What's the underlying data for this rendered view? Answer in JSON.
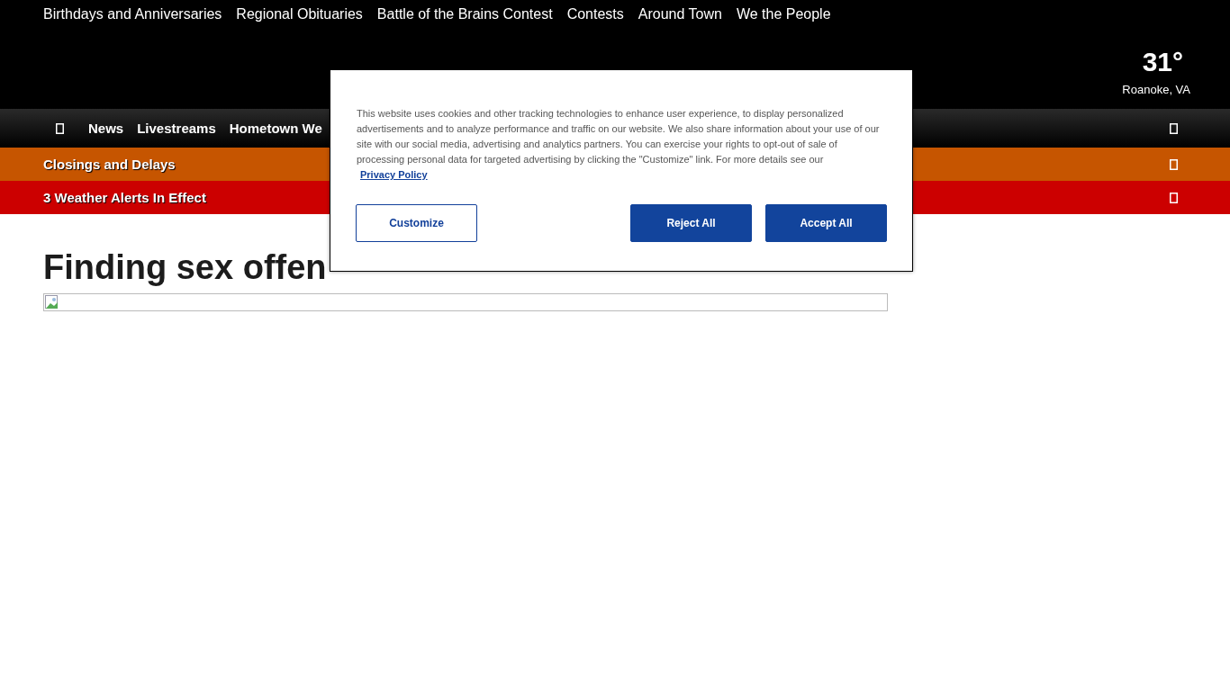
{
  "top_links": [
    "Birthdays and Anniversaries",
    "Regional Obituaries",
    "Battle of the Brains Contest",
    "Contests",
    "Around Town",
    "We the People"
  ],
  "weather": {
    "temperature": "31°",
    "location": "Roanoke, VA"
  },
  "nav": {
    "items": [
      "News",
      "Livestreams",
      "Hometown We"
    ]
  },
  "alert_bars": [
    {
      "label": "Closings and Delays",
      "color": "#c65500"
    },
    {
      "label": "3 Weather Alerts In Effect",
      "color": "#cc0000"
    }
  ],
  "article": {
    "headline": "Finding sex offen"
  },
  "cookie_dialog": {
    "text": "This website uses cookies and other tracking technologies to enhance user experience, to display personalized advertisements and to analyze performance and traffic on our website. We also share information about your use of our site with our social media, advertising and analytics partners. You can exercise your rights to opt-out of sale of processing personal data for targeted advertising by clicking the \"Customize\" link. For more details see our ",
    "link": "Privacy Policy",
    "buttons": [
      {
        "label": "Customize",
        "kind": "outline"
      },
      {
        "label": "Reject All",
        "kind": "filled"
      },
      {
        "label": "Accept All",
        "kind": "filled"
      }
    ]
  }
}
